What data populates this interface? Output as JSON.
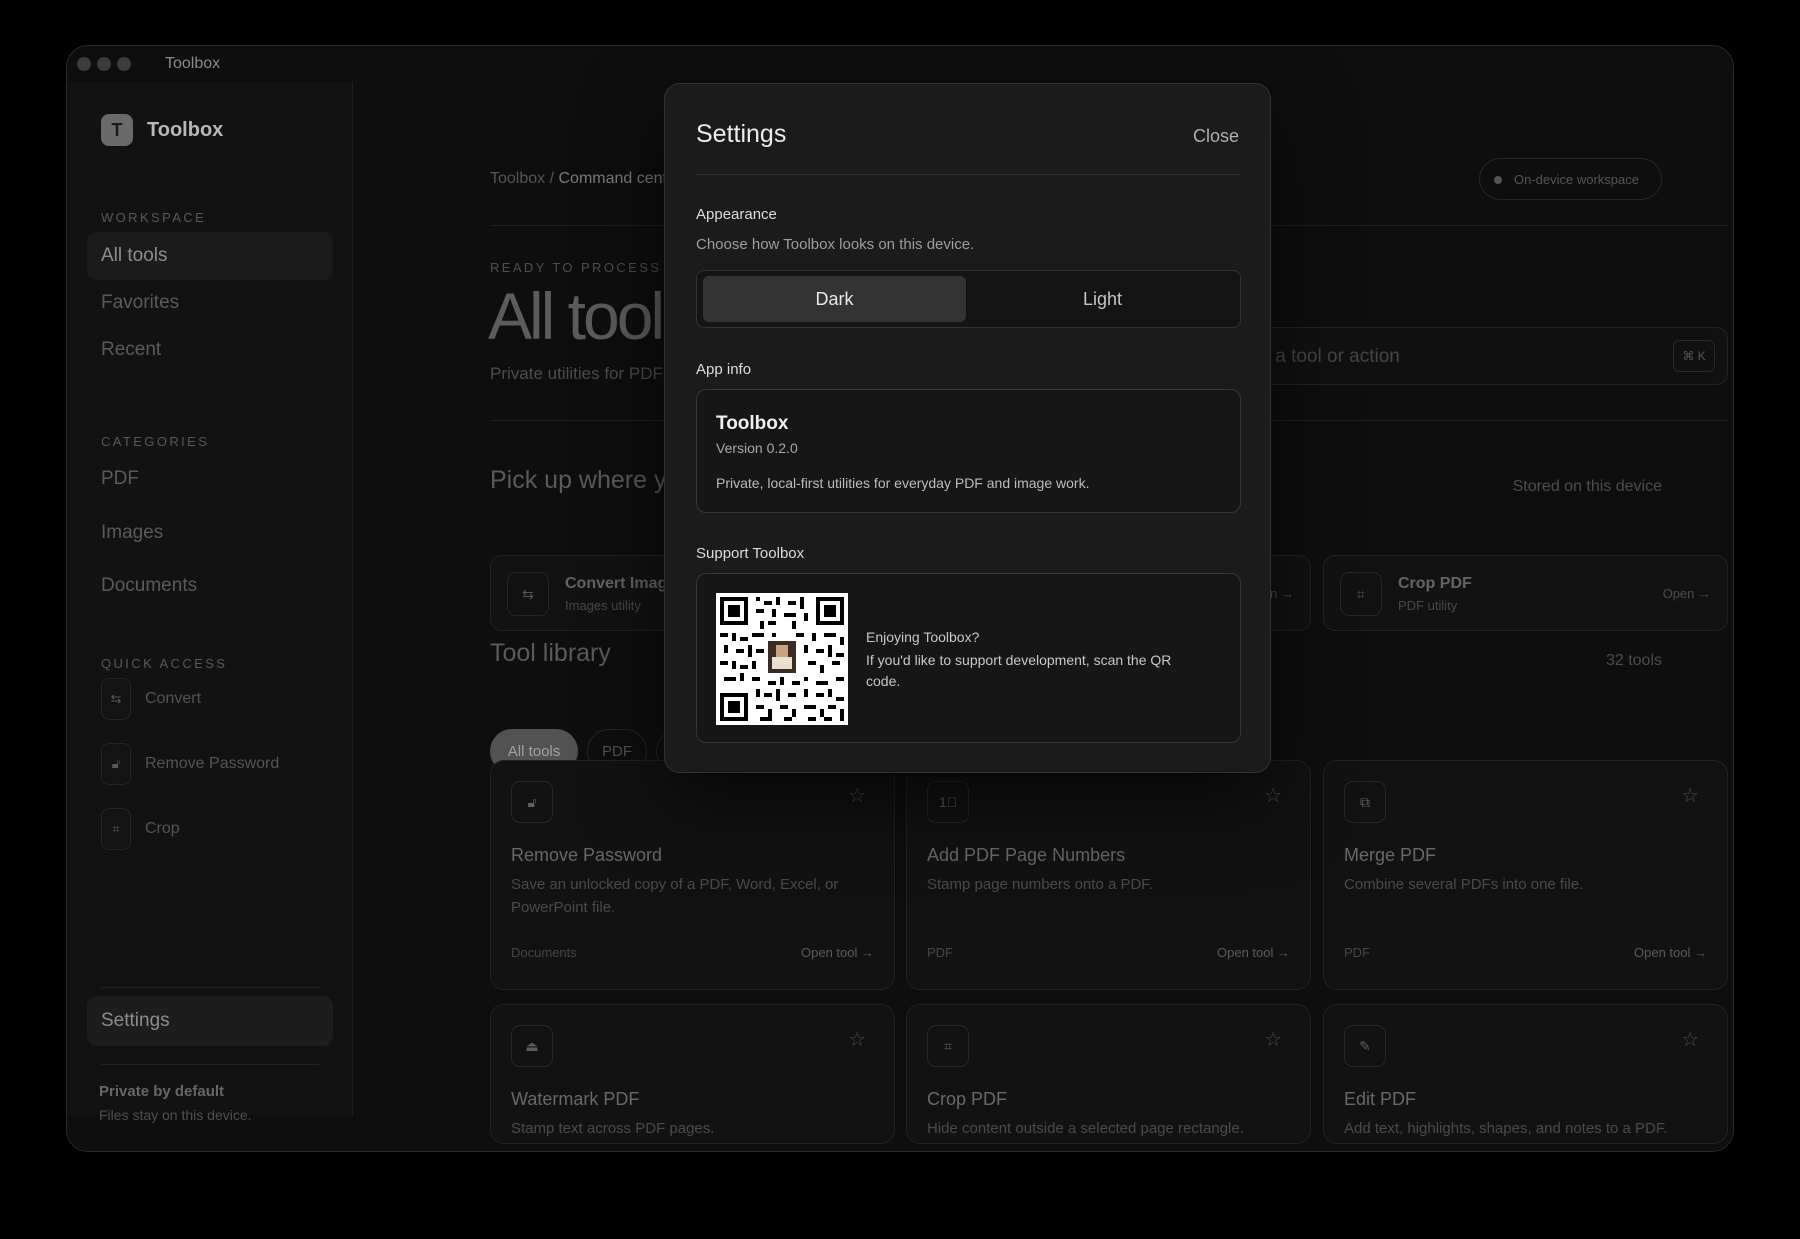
{
  "window": {
    "title": "Toolbox"
  },
  "sidebar": {
    "brand_letter": "T",
    "brand_name": "Toolbox",
    "workspace_label": "WORKSPACE",
    "workspace_items": [
      {
        "label": "All tools",
        "active": true
      },
      {
        "label": "Favorites"
      },
      {
        "label": "Recent"
      }
    ],
    "categories_label": "CATEGORIES",
    "category_items": [
      {
        "label": "PDF"
      },
      {
        "label": "Images"
      },
      {
        "label": "Documents"
      }
    ],
    "quick_label": "QUICK ACCESS",
    "quick_items": [
      {
        "label": "Convert",
        "icon": "convert-icon"
      },
      {
        "label": "Remove Password",
        "icon": "unlock-icon"
      },
      {
        "label": "Crop",
        "icon": "crop-icon"
      }
    ],
    "settings_label": "Settings",
    "privacy_title": "Private by default",
    "privacy_sub": "Files stay on this device."
  },
  "main": {
    "breadcrumb_root": "Toolbox",
    "breadcrumb_sep": " / ",
    "breadcrumb_current": "Command cent",
    "workspace_pill": "On-device workspace",
    "eyebrow": "READY TO PROCESS",
    "title": "All tools",
    "subtitle": "Private utilities for PDFs",
    "search_placeholder": "Find a tool or action",
    "search_shortcut": "⌘ K",
    "recent_title": "Pick up where y",
    "recent_note": "Stored on this device",
    "recent_cards": [
      {
        "title": "Convert Imag",
        "sub": "Images utility",
        "open": ""
      },
      {
        "title": "",
        "sub": "",
        "open": "n →"
      },
      {
        "title": "Crop PDF",
        "sub": "PDF utility",
        "open": "Open →"
      }
    ],
    "library_title": "Tool library",
    "library_count": "32 tools",
    "filters": [
      {
        "label": "All tools",
        "active": true
      },
      {
        "label": "PDF"
      }
    ],
    "tools": [
      {
        "title": "Remove Password",
        "desc": "Save an unlocked copy of a PDF, Word, Excel, or PowerPoint file.",
        "category": "Documents",
        "open": "Open tool →",
        "icon": "unlock-icon"
      },
      {
        "title": "Add PDF Page Numbers",
        "desc": "Stamp page numbers onto a PDF.",
        "category": "PDF",
        "open": "Open tool →",
        "icon": "page-numbers-icon"
      },
      {
        "title": "Merge PDF",
        "desc": "Combine several PDFs into one file.",
        "category": "PDF",
        "open": "Open tool →",
        "icon": "merge-icon"
      },
      {
        "title": "Watermark PDF",
        "desc": "Stamp text across PDF pages.",
        "category": "",
        "open": "",
        "icon": "stamp-icon"
      },
      {
        "title": "Crop PDF",
        "desc": "Hide content outside a selected page rectangle.",
        "category": "",
        "open": "",
        "icon": "crop-icon"
      },
      {
        "title": "Edit PDF",
        "desc": "Add text, highlights, shapes, and notes to a PDF.",
        "category": "",
        "open": "",
        "icon": "edit-document-icon"
      }
    ]
  },
  "modal": {
    "title": "Settings",
    "close_label": "Close",
    "appearance_label": "Appearance",
    "appearance_sub": "Choose how Toolbox looks on this device.",
    "theme_dark": "Dark",
    "theme_light": "Light",
    "selected_theme": "Dark",
    "app_info_label": "App info",
    "app_name": "Toolbox",
    "app_version": "Version 0.2.0",
    "app_desc": "Private, local-first utilities for everyday PDF and image work.",
    "support_label": "Support Toolbox",
    "support_title": "Enjoying Toolbox?",
    "support_text": "If you'd like to support development, scan the QR code."
  }
}
